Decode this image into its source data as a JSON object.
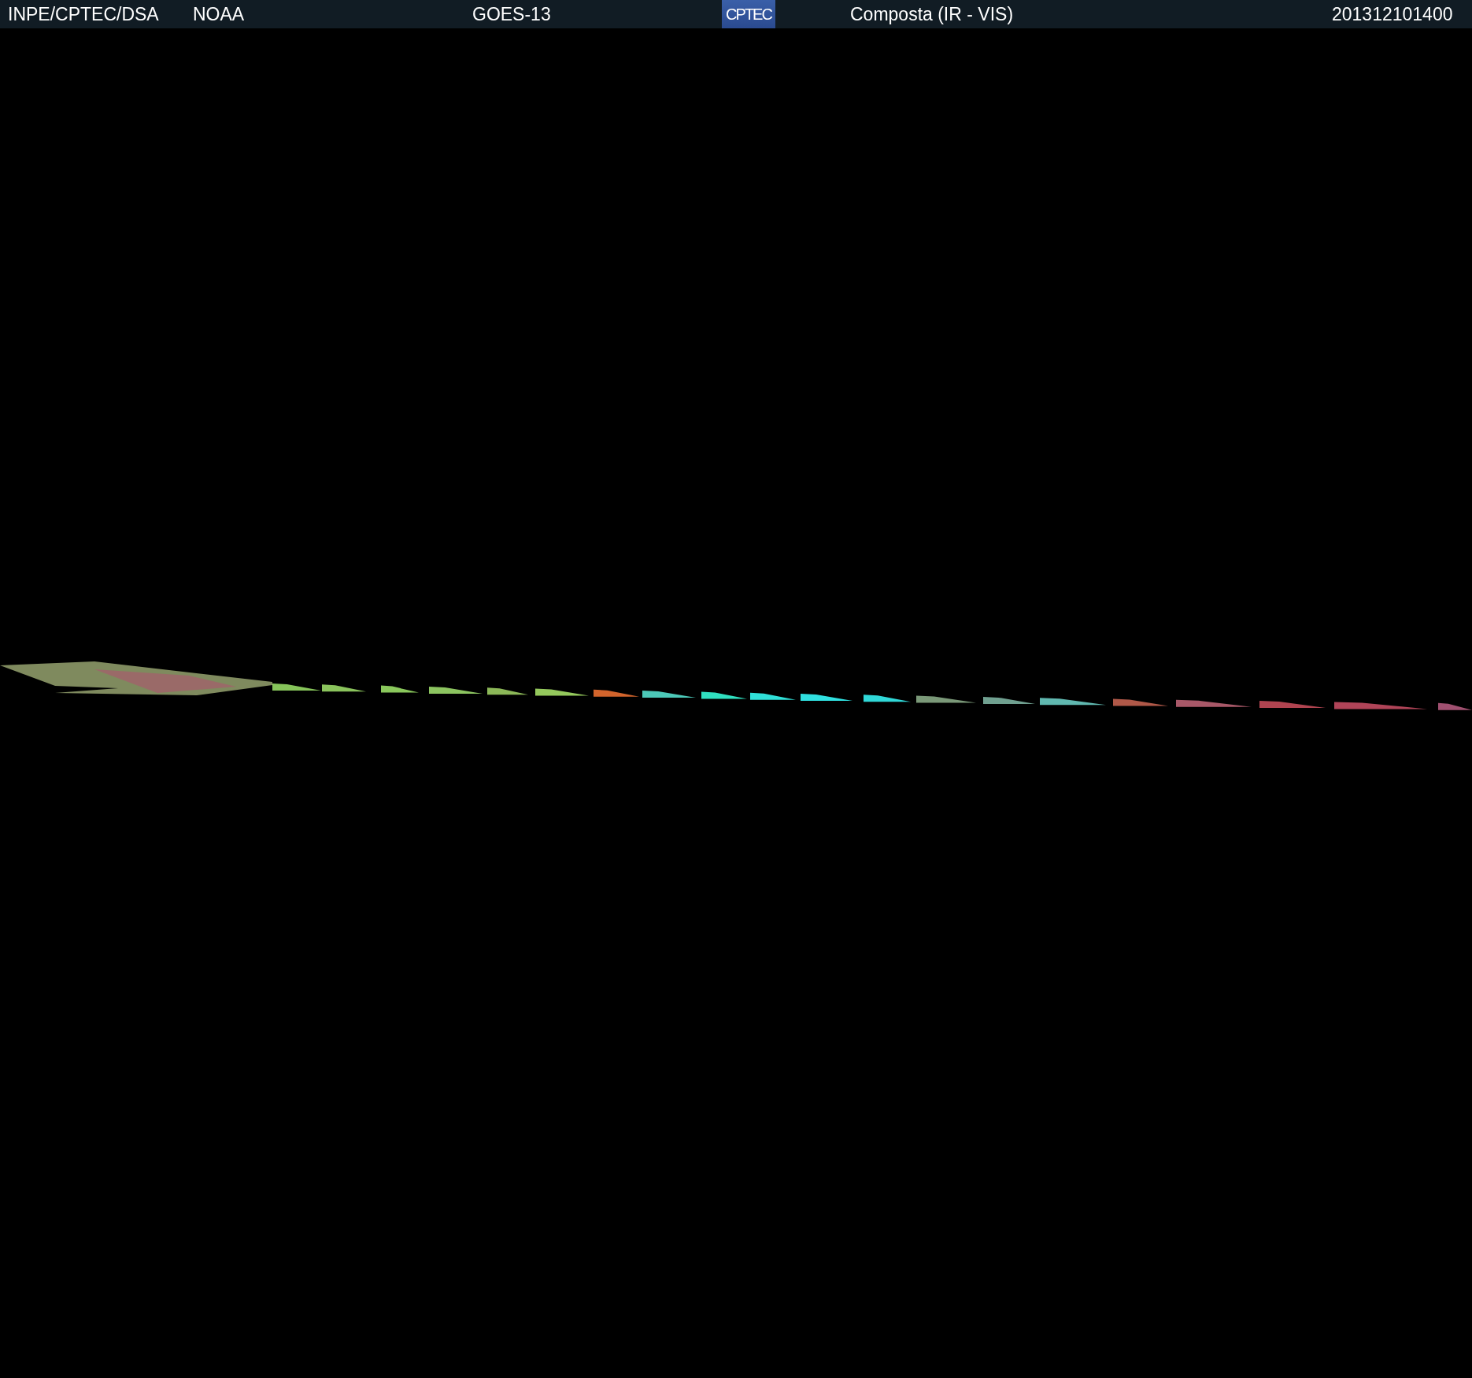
{
  "header": {
    "items": [
      {
        "kind": "text",
        "text": "INPE/CPTEC/DSA"
      },
      {
        "kind": "text",
        "text": "NOAA"
      },
      {
        "kind": "text",
        "text": "GOES-13"
      },
      {
        "kind": "logo",
        "text": "CPTEC"
      },
      {
        "kind": "text",
        "text": "Composta (IR - VIS)"
      },
      {
        "kind": "text",
        "text": "201312101400"
      }
    ]
  }
}
